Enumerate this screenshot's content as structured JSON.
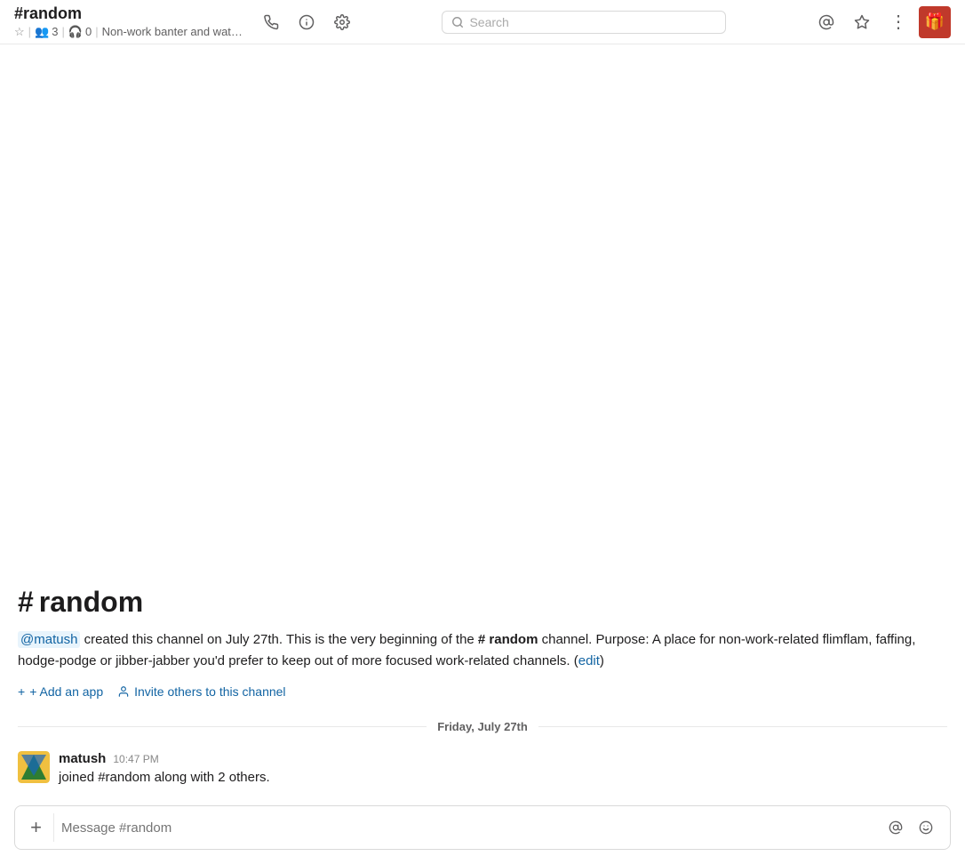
{
  "header": {
    "channel_name": "#random",
    "star_label": "★",
    "members_count": "3",
    "members_icon": "👥",
    "huddle_count": "0",
    "huddle_icon": "🎧",
    "channel_description": "Non-work banter and wat…",
    "info_icon": "ℹ",
    "settings_icon": "⚙",
    "search_placeholder": "Search",
    "mention_icon": "@",
    "star_header_icon": "☆",
    "more_icon": "⋮",
    "gift_icon": "🎁"
  },
  "channel_intro": {
    "hash": "#",
    "name": "random",
    "description_mention": "@matush",
    "description_text": " created this channel on July 27th. This is the very beginning of the ",
    "channel_name_bold": "# random",
    "description_rest": " channel. Purpose: A place for non-work-related flimflam, faffing, hodge-podge or jibber-jabber you'd prefer to keep out of more focused work-related channels. (",
    "edit_label": "edit",
    "description_end": ")",
    "add_app_label": "+ Add an app",
    "invite_label": "Invite others to this channel"
  },
  "date_divider": {
    "text": "Friday, July 27th"
  },
  "messages": [
    {
      "author": "matush",
      "time": "10:47 PM",
      "text": "joined #random along with 2 others."
    }
  ],
  "message_input": {
    "placeholder": "Message #random",
    "plus_icon": "+",
    "mention_icon": "@",
    "emoji_icon": "😊"
  }
}
